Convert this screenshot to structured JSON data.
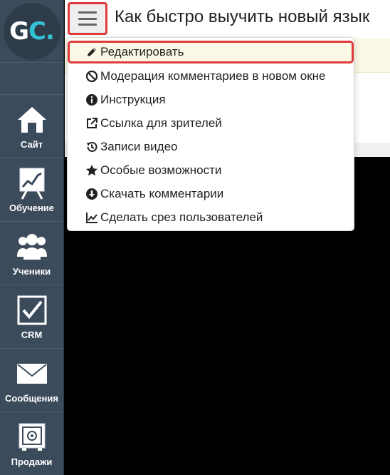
{
  "sidebar": {
    "logo": {
      "g": "G",
      "c": "C",
      "dot": "."
    },
    "items": [
      {
        "label": "Сайт",
        "icon": "home-icon"
      },
      {
        "label": "Обучение",
        "icon": "chart-board-icon"
      },
      {
        "label": "Ученики",
        "icon": "users-icon"
      },
      {
        "label": "CRM",
        "icon": "checkbox-icon"
      },
      {
        "label": "Сообщения",
        "icon": "envelope-icon"
      },
      {
        "label": "Продажи",
        "icon": "safe-icon"
      }
    ]
  },
  "header": {
    "title": "Как быстро выучить новый язык",
    "menu_icon": "hamburger-icon"
  },
  "dropdown": {
    "items": [
      {
        "label": "Редактировать",
        "icon": "pencil-icon",
        "active": true
      },
      {
        "label": "Модерация комментариев в новом окне",
        "icon": "ban-icon"
      },
      {
        "label": "Инструкция",
        "icon": "info-icon"
      },
      {
        "label": "Ссылка для зрителей",
        "icon": "external-link-icon"
      },
      {
        "label": "Записи видео",
        "icon": "history-icon"
      },
      {
        "label": "Особые возможности",
        "icon": "star-icon"
      },
      {
        "label": "Скачать комментарии",
        "icon": "download-icon"
      },
      {
        "label": "Сделать срез пользователей",
        "icon": "line-chart-icon"
      }
    ]
  },
  "colors": {
    "sidebar_bg": "#3b4b5c",
    "highlight": "#e03a3a",
    "accent": "#33c1d4"
  }
}
